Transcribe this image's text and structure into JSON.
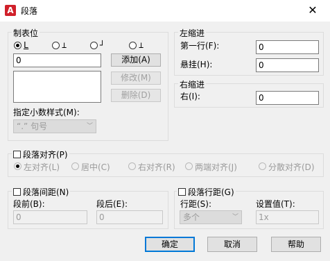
{
  "window": {
    "title": "段落",
    "app_icon_letter": "A",
    "close_glyph": "✕"
  },
  "tabs_group": {
    "title": "制表位",
    "tab_stop_glyphs": [
      "L",
      "⊥",
      "┘",
      "⊥"
    ],
    "position_value": "0",
    "add_button": "添加(A)",
    "modify_button": "修改(M)",
    "delete_button": "删除(D)",
    "decimal_label": "指定小数样式(M):",
    "decimal_value": "“.” 句号"
  },
  "left_indent": {
    "title": "左缩进",
    "first_line_label": "第一行(F):",
    "first_line_value": "0",
    "hanging_label": "悬挂(H):",
    "hanging_value": "0"
  },
  "right_indent": {
    "title": "右缩进",
    "right_label": "右(I):",
    "right_value": "0"
  },
  "alignment": {
    "checkbox_label": "段落对齐(P)",
    "options": [
      "左对齐(L)",
      "居中(C)",
      "右对齐(R)",
      "两端对齐(J)",
      "分散对齐(D)"
    ]
  },
  "spacing": {
    "checkbox_label": "段落间距(N)",
    "before_label": "段前(B):",
    "before_value": "0",
    "after_label": "段后(E):",
    "after_value": "0"
  },
  "line_spacing": {
    "checkbox_label": "段落行距(G)",
    "line_label": "行距(S):",
    "line_value": "多个",
    "set_label": "设置值(T):",
    "set_value": "1x"
  },
  "buttons": {
    "ok": "确定",
    "cancel": "取消",
    "help": "帮助"
  }
}
